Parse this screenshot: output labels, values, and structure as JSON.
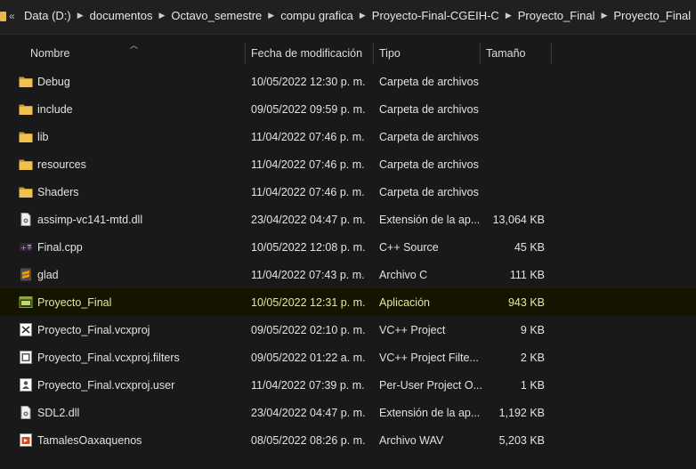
{
  "address_bar": {
    "breadcrumbs": [
      "Data (D:)",
      "documentos",
      "Octavo_semestre",
      "compu grafica",
      "Proyecto-Final-CGEIH-C",
      "Proyecto_Final",
      "Proyecto_Final"
    ]
  },
  "columns": {
    "name": "Nombre",
    "date": "Fecha de modificación",
    "type": "Tipo",
    "size": "Tamaño",
    "sort_icon": "chevron-up-icon"
  },
  "files": [
    {
      "name": "Debug",
      "date": "10/05/2022 12:30 p. m.",
      "type": "Carpeta de archivos",
      "size": "",
      "icon": "folder-icon"
    },
    {
      "name": "include",
      "date": "09/05/2022 09:59 p. m.",
      "type": "Carpeta de archivos",
      "size": "",
      "icon": "folder-icon"
    },
    {
      "name": "lib",
      "date": "11/04/2022 07:46 p. m.",
      "type": "Carpeta de archivos",
      "size": "",
      "icon": "folder-icon"
    },
    {
      "name": "resources",
      "date": "11/04/2022 07:46 p. m.",
      "type": "Carpeta de archivos",
      "size": "",
      "icon": "folder-icon"
    },
    {
      "name": "Shaders",
      "date": "11/04/2022 07:46 p. m.",
      "type": "Carpeta de archivos",
      "size": "",
      "icon": "folder-icon"
    },
    {
      "name": "assimp-vc141-mtd.dll",
      "date": "23/04/2022 04:47 p. m.",
      "type": "Extensión de la ap...",
      "size": "13,064 KB",
      "icon": "dll-file-icon"
    },
    {
      "name": "Final.cpp",
      "date": "10/05/2022 12:08 p. m.",
      "type": "C++ Source",
      "size": "45 KB",
      "icon": "cpp-file-icon"
    },
    {
      "name": "glad",
      "date": "11/04/2022 07:43 p. m.",
      "type": "Archivo C",
      "size": "111 KB",
      "icon": "sublime-file-icon"
    },
    {
      "name": "Proyecto_Final",
      "date": "10/05/2022 12:31 p. m.",
      "type": "Aplicación",
      "size": "943 KB",
      "icon": "exe-file-icon",
      "selected": true
    },
    {
      "name": "Proyecto_Final.vcxproj",
      "date": "09/05/2022 02:10 p. m.",
      "type": "VC++ Project",
      "size": "9 KB",
      "icon": "vcxproj-file-icon"
    },
    {
      "name": "Proyecto_Final.vcxproj.filters",
      "date": "09/05/2022 01:22 a. m.",
      "type": "VC++ Project Filte...",
      "size": "2 KB",
      "icon": "filters-file-icon"
    },
    {
      "name": "Proyecto_Final.vcxproj.user",
      "date": "11/04/2022 07:39 p. m.",
      "type": "Per-User Project O...",
      "size": "1 KB",
      "icon": "user-file-icon"
    },
    {
      "name": "SDL2.dll",
      "date": "23/04/2022 04:47 p. m.",
      "type": "Extensión de la ap...",
      "size": "1,192 KB",
      "icon": "dll-file-icon"
    },
    {
      "name": "TamalesOaxaquenos",
      "date": "08/05/2022 08:26 p. m.",
      "type": "Archivo WAV",
      "size": "5,203 KB",
      "icon": "wav-file-icon"
    }
  ],
  "colors": {
    "background": "#191919",
    "folder": "#e8b84c",
    "selected_row_bg": "#141400",
    "selected_text": "#e9e69a"
  }
}
